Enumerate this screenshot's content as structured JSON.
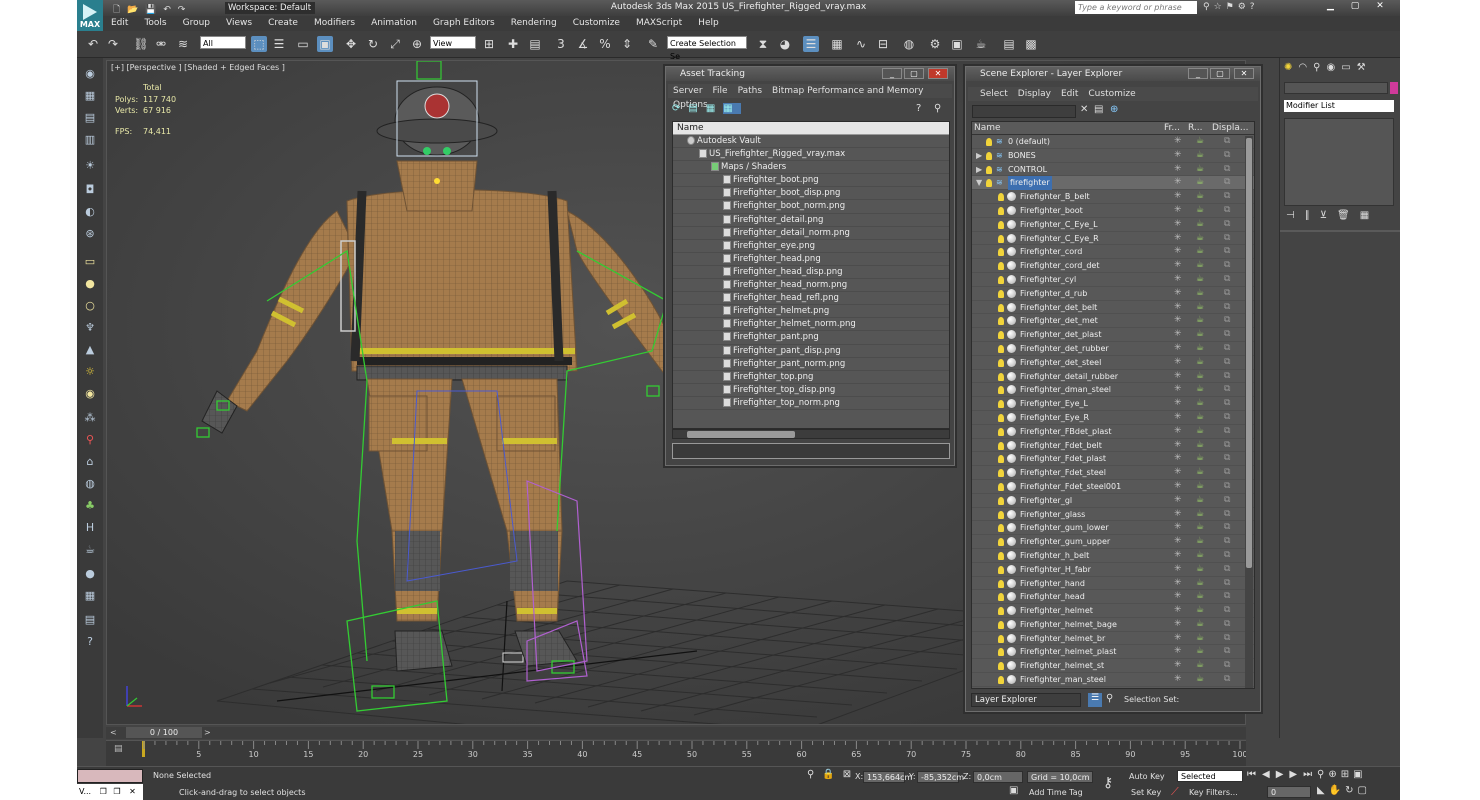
{
  "app": {
    "title": "Autodesk 3ds Max 2015    US_Firefighter_Rigged_vray.max",
    "logo": "MAX",
    "workspace": "Workspace: Default",
    "search_placeholder": "Type a keyword or phrase"
  },
  "menu": [
    "Edit",
    "Tools",
    "Group",
    "Views",
    "Create",
    "Modifiers",
    "Animation",
    "Graph Editors",
    "Rendering",
    "Customize",
    "MAXScript",
    "Help"
  ],
  "toolbar": {
    "filter": "All",
    "refcoord": "View",
    "selection_set": "Create Selection Se"
  },
  "viewport": {
    "label": "[+] [Perspective ] [Shaded + Edged Faces ]",
    "stats_header": "Total",
    "polys_label": "Polys:",
    "polys_value": "117 740",
    "verts_label": "Verts:",
    "verts_value": "67 916",
    "fps_label": "FPS:",
    "fps_value": "74,411"
  },
  "asset_tracking": {
    "title": "Asset Tracking",
    "menu": [
      "Server",
      "File",
      "Paths",
      "Bitmap Performance and Memory",
      "Options"
    ],
    "column": "Name",
    "items": [
      {
        "name": "Autodesk Vault",
        "level": 0
      },
      {
        "name": "US_Firefighter_Rigged_vray.max",
        "level": 1
      },
      {
        "name": "Maps / Shaders",
        "level": 2
      },
      {
        "name": "Firefighter_boot.png",
        "level": 3
      },
      {
        "name": "Firefighter_boot_disp.png",
        "level": 3
      },
      {
        "name": "Firefighter_boot_norm.png",
        "level": 3
      },
      {
        "name": "Firefighter_detail.png",
        "level": 3
      },
      {
        "name": "Firefighter_detail_norm.png",
        "level": 3
      },
      {
        "name": "Firefighter_eye.png",
        "level": 3
      },
      {
        "name": "Firefighter_head.png",
        "level": 3
      },
      {
        "name": "Firefighter_head_disp.png",
        "level": 3
      },
      {
        "name": "Firefighter_head_norm.png",
        "level": 3
      },
      {
        "name": "Firefighter_head_refl.png",
        "level": 3
      },
      {
        "name": "Firefighter_helmet.png",
        "level": 3
      },
      {
        "name": "Firefighter_helmet_norm.png",
        "level": 3
      },
      {
        "name": "Firefighter_pant.png",
        "level": 3
      },
      {
        "name": "Firefighter_pant_disp.png",
        "level": 3
      },
      {
        "name": "Firefighter_pant_norm.png",
        "level": 3
      },
      {
        "name": "Firefighter_top.png",
        "level": 3
      },
      {
        "name": "Firefighter_top_disp.png",
        "level": 3
      },
      {
        "name": "Firefighter_top_norm.png",
        "level": 3
      }
    ]
  },
  "scene_explorer": {
    "title": "Scene Explorer - Layer Explorer",
    "menu": [
      "Select",
      "Display",
      "Edit",
      "Customize"
    ],
    "columns": [
      "Name",
      "Fr...",
      "R...",
      "Displa..."
    ],
    "layers": [
      {
        "name": "0 (default)",
        "type": "layer"
      },
      {
        "name": "BONES",
        "type": "layer"
      },
      {
        "name": "CONTROL",
        "type": "layer"
      },
      {
        "name": "firefighter",
        "type": "layer",
        "selected": true
      }
    ],
    "objects": [
      "Firefighter_B_belt",
      "Firefighter_boot",
      "Firefighter_C_Eye_L",
      "Firefighter_C_Eye_R",
      "Firefighter_cord",
      "Firefighter_cord_det",
      "Firefighter_cyl",
      "Firefighter_d_rub",
      "Firefighter_det_belt",
      "Firefighter_det_met",
      "Firefighter_det_plast",
      "Firefighter_det_rubber",
      "Firefighter_det_steel",
      "Firefighter_detail_rubber",
      "Firefighter_dman_steel",
      "Firefighter_Eye_L",
      "Firefighter_Eye_R",
      "Firefighter_FBdet_plast",
      "Firefighter_Fdet_belt",
      "Firefighter_Fdet_plast",
      "Firefighter_Fdet_steel",
      "Firefighter_Fdet_steel001",
      "Firefighter_gl",
      "Firefighter_glass",
      "Firefighter_gum_lower",
      "Firefighter_gum_upper",
      "Firefighter_h_belt",
      "Firefighter_H_fabr",
      "Firefighter_hand",
      "Firefighter_head",
      "Firefighter_helmet",
      "Firefighter_helmet_bage",
      "Firefighter_helmet_br",
      "Firefighter_helmet_plast",
      "Firefighter_helmet_st",
      "Firefighter_man_steel"
    ],
    "footer_mode": "Layer Explorer",
    "selection_set_label": "Selection Set:"
  },
  "command_panel": {
    "modifier_list": "Modifier List"
  },
  "timeline": {
    "frame": "0 / 100",
    "ticks": [
      "5",
      "10",
      "15",
      "20",
      "25",
      "30",
      "35",
      "40",
      "45",
      "50",
      "55",
      "60",
      "65",
      "70",
      "75",
      "80",
      "85",
      "90",
      "95",
      "100"
    ]
  },
  "status": {
    "selection": "None Selected",
    "prompt": "Click-and-drag to select objects",
    "x_label": "X:",
    "x_value": "153,664cm",
    "y_label": "Y:",
    "y_value": "-85,352cm",
    "z_label": "Z:",
    "z_value": "0,0cm",
    "grid": "Grid = 10,0cm",
    "add_time_tag": "Add Time Tag",
    "auto_key": "Auto Key",
    "set_key": "Set Key",
    "selected": "Selected",
    "key_filters": "Key Filters...",
    "frame_field": "0",
    "taskbar": "V..."
  }
}
